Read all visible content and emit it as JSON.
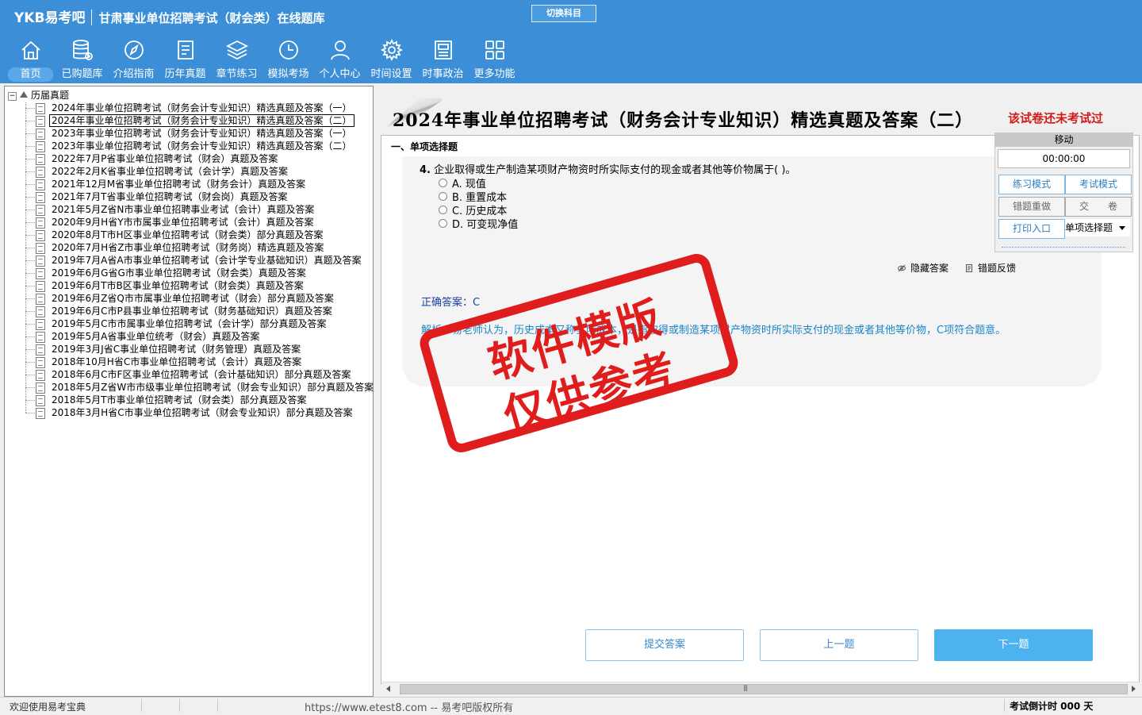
{
  "header": {
    "logo": "YKB易考吧",
    "app_title": "甘肃事业单位招聘考试（财会类）在线题库",
    "switch_subject": "切换科目",
    "nav": [
      {
        "label": "首页",
        "icon": "home-icon"
      },
      {
        "label": "已购题库",
        "icon": "database-icon"
      },
      {
        "label": "介绍指南",
        "icon": "compass-icon"
      },
      {
        "label": "历年真题",
        "icon": "document-list-icon"
      },
      {
        "label": "章节练习",
        "icon": "layers-icon"
      },
      {
        "label": "模拟考场",
        "icon": "clock-icon"
      },
      {
        "label": "个人中心",
        "icon": "user-icon"
      },
      {
        "label": "时间设置",
        "icon": "gear-icon"
      },
      {
        "label": "时事政治",
        "icon": "newspaper-icon"
      },
      {
        "label": "更多功能",
        "icon": "grid-icon"
      }
    ]
  },
  "tree": {
    "root_label": "历届真题",
    "expander": "−",
    "items": [
      "2024年事业单位招聘考试（财务会计专业知识）精选真题及答案（一）",
      "2024年事业单位招聘考试（财务会计专业知识）精选真题及答案（二）",
      "2023年事业单位招聘考试（财务会计专业知识）精选真题及答案（一）",
      "2023年事业单位招聘考试（财务会计专业知识）精选真题及答案（二）",
      "2022年7月P省事业单位招聘考试（财会）真题及答案",
      "2022年2月K省事业单位招聘考试（会计学）真题及答案",
      "2021年12月M省事业单位招聘考试（财务会计）真题及答案",
      "2021年7月T省事业单位招聘考试（财会岗）真题及答案",
      "2021年5月Z省N市事业单位招聘事业考试（会计）真题及答案",
      "2020年9月H省Y市市属事业单位招聘考试（会计）真题及答案",
      "2020年8月T市H区事业单位招聘考试（财会类）部分真题及答案",
      "2020年7月H省Z市事业单位招聘考试（财务岗）精选真题及答案",
      "2019年7月A省A市事业单位招聘考试（会计学专业基础知识）真题及答案",
      "2019年6月G省G市事业单位招聘考试（财会类）真题及答案",
      "2019年6月T市B区事业单位招聘考试（财会类）真题及答案",
      "2019年6月Z省Q市市属事业单位招聘考试（财会）部分真题及答案",
      "2019年6月C市P县事业单位招聘考试（财务基础知识）真题及答案",
      "2019年5月C市市属事业单位招聘考试（会计学）部分真题及答案",
      "2019年5月A省事业单位统考（财会）真题及答案",
      "2019年3月J省C事业单位招聘考试（财务管理）真题及答案",
      "2018年10月H省C市事业单位招聘考试（会计）真题及答案",
      "2018年6月C市F区事业单位招聘考试（会计基础知识）部分真题及答案",
      "2018年5月Z省W市市级事业单位招聘考试（财会专业知识）部分真题及答案",
      "2018年5月T市事业单位招聘考试（财会类）部分真题及答案",
      "2018年3月H省C市事业单位招聘考试（财会专业知识）部分真题及答案"
    ]
  },
  "main": {
    "title": "2024年事业单位招聘考试（财务会计专业知识）精选真题及答案（二）",
    "not_tested": "该试卷还未考试过",
    "section": "一、单项选择题",
    "question_number": "4.",
    "question_text": "企业取得或生产制造某项财产物资时所实际支付的现金或者其他等价物属于( )。",
    "options": [
      "A. 现值",
      "B. 重置成本",
      "C. 历史成本",
      "D. 可变现净值"
    ],
    "hide_answer": "隐藏答案",
    "error_feedback": "错题反馈",
    "correct_answer": "正确答案：C",
    "analysis": "解析：易老师认为，历史成本又称实际成本，是指取得或制造某项财产物资时所实际支付的现金或者其他等价物，C项符合题意。"
  },
  "mode_panel": {
    "move": "移动",
    "timer": "00:00:00",
    "practice_mode": "练习模式",
    "exam_mode": "考试模式",
    "redo_wrong": "错题重做",
    "submit_paper": "交　　卷",
    "print_entry": "打印入口",
    "question_type": "单项选择题"
  },
  "buttons": {
    "submit_answer": "提交答案",
    "prev": "上一题",
    "next": "下一题"
  },
  "scrollbar": {
    "grip": "|||"
  },
  "status": {
    "welcome": "欢迎使用易考宝典",
    "url": "https://www.etest8.com -- 易考吧版权所有",
    "countdown": "考试倒计时 000 天"
  },
  "watermark": {
    "line1": "软件模版",
    "line2": "仅供参考"
  },
  "colors": {
    "header_bg": "#3c8fd6",
    "accent": "#4db3f0",
    "stamp_red": "#e01d1d",
    "warning_red": "#d21a1a"
  }
}
